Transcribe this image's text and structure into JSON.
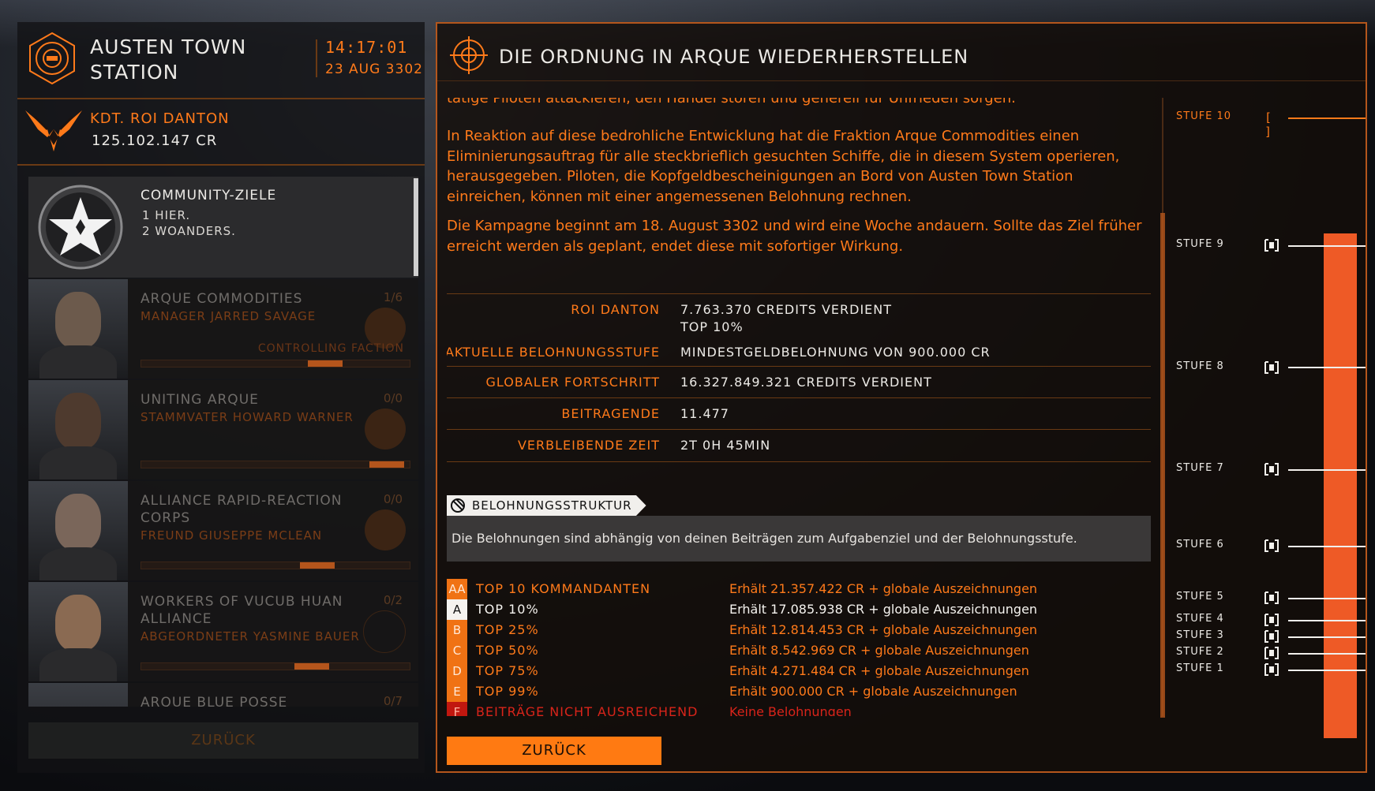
{
  "station": {
    "name_line1": "AUSTEN TOWN",
    "name_line2": "STATION",
    "time": "14:17:01",
    "date": "23 AUG 3302"
  },
  "commander": {
    "name": "KDT. ROI DANTON",
    "credits": "125.102.147 CR"
  },
  "community_goals": {
    "title": "COMMUNITY-ZIELE",
    "line1": "1 HIER.",
    "line2": "2 WOANDERS."
  },
  "factions": [
    {
      "name": "ARQUE COMMODITIES",
      "leader": "MANAGER JARRED SAVAGE",
      "count": "1/6",
      "tag": "CONTROLLING FACTION",
      "progress": 0.75
    },
    {
      "name": "UNITING ARQUE",
      "leader": "STAMMVATER HOWARD WARNER",
      "count": "0/0",
      "tag": "",
      "progress": 0.98
    },
    {
      "name": "ALLIANCE RAPID-REACTION CORPS",
      "leader": "FREUND GIUSEPPE MCLEAN",
      "count": "0/0",
      "tag": "",
      "progress": 0.72
    },
    {
      "name": "WORKERS OF VUCUB HUAN ALLIANCE",
      "leader": "ABGEORDNETER YASMINE BAUER",
      "count": "0/2",
      "tag": "",
      "progress": 0.7
    },
    {
      "name": "ARQUE BLUE POSSE",
      "leader": "",
      "count": "0/7",
      "tag": "",
      "progress": 0
    }
  ],
  "left_back_label": "ZURÜCK",
  "mission": {
    "title": "DIE ORDNUNG IN ARQUE WIEDERHERSTELLEN",
    "para0": "tätige Piloten attackieren, den Handel stören und generell für Unfrieden sorgen.",
    "para1": "In Reaktion auf diese bedrohliche Entwicklung hat die Fraktion Arque Commodities einen Eliminierungsauftrag für alle steckbrieflich gesuchten Schiffe, die in diesem System operieren, herausgegeben. Piloten, die Kopfgeldbescheinigungen an Bord von Austen Town Station einreichen, können mit einer angemessenen Belohnung rechnen.",
    "para2": "Die Kampagne beginnt am 18. August 3302 und wird eine Woche andauern. Sollte das Ziel früher erreicht werden als geplant, endet diese mit sofortiger Wirkung."
  },
  "stats": {
    "player_label": "ROI DANTON",
    "player_value1": "7.763.370 CREDITS VERDIENT",
    "player_value2": "TOP 10%",
    "tier_label": "AKTUELLE BELOHNUNGSSTUFE",
    "tier_value": "MINDESTGELDBELOHNUNG VON 900.000 CR",
    "global_label": "GLOBALER FORTSCHRITT",
    "global_value": "16.327.849.321 CREDITS VERDIENT",
    "contrib_label": "BEITRAGENDE",
    "contrib_value": "11.477",
    "time_label": "VERBLEIBENDE ZEIT",
    "time_value": "2T 0H 45MIN"
  },
  "reward_structure": {
    "tab": "BELOHNUNGSSTRUKTUR",
    "description": "Die Belohnungen sind abhängig von deinen Beiträgen zum Aufgabenziel und der Belohnungsstufe.",
    "tiers": [
      {
        "badge": "AA",
        "name": "TOP 10 KOMMANDANTEN",
        "reward": "Erhält 21.357.422 CR + globale Auszeichnungen"
      },
      {
        "badge": "A",
        "name": "TOP 10%",
        "reward": "Erhält 17.085.938 CR + globale Auszeichnungen"
      },
      {
        "badge": "B",
        "name": "TOP 25%",
        "reward": "Erhält 12.814.453 CR + globale Auszeichnungen"
      },
      {
        "badge": "C",
        "name": "TOP 50%",
        "reward": "Erhält 8.542.969 CR + globale Auszeichnungen"
      },
      {
        "badge": "D",
        "name": "TOP 75%",
        "reward": "Erhält 4.271.484 CR + globale Auszeichnungen"
      },
      {
        "badge": "E",
        "name": "TOP 99%",
        "reward": "Erhält 900.000 CR + globale Auszeichnungen"
      },
      {
        "badge": "F",
        "name": "BEITRÄGE NICHT AUSREICHEND",
        "reward": "Keine Belohnungen"
      }
    ]
  },
  "levels": [
    {
      "label": "STUFE 10",
      "box": "[ ]"
    },
    {
      "label": "STUFE 9"
    },
    {
      "label": "STUFE 8"
    },
    {
      "label": "STUFE 7"
    },
    {
      "label": "STUFE 6"
    },
    {
      "label": "STUFE 5"
    },
    {
      "label": "STUFE 4"
    },
    {
      "label": "STUFE 3"
    },
    {
      "label": "STUFE 2"
    },
    {
      "label": "STUFE 1"
    }
  ],
  "main_back_label": "ZURÜCK",
  "colors": {
    "accent": "#ff7a1a",
    "bar": "#ee5a26",
    "alert": "#d9241a"
  }
}
